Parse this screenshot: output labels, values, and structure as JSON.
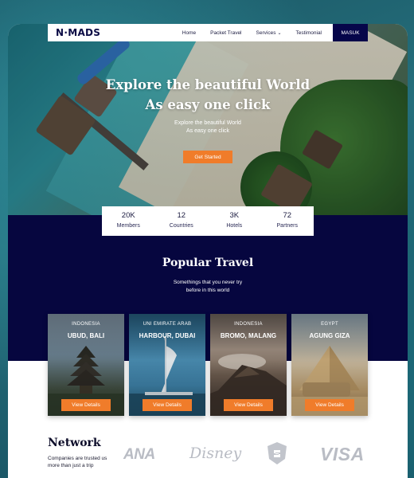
{
  "nav": {
    "logo": "N·MADS",
    "links": [
      "Home",
      "Packet Travel",
      "Services",
      "Testimonial"
    ],
    "cta": "MASUK"
  },
  "hero": {
    "title_line1": "Explore the beautiful World",
    "title_line2": "As easy one click",
    "sub_line1": "Explore the beautiful World",
    "sub_line2": "As easy one click",
    "cta": "Get Started"
  },
  "stats": [
    {
      "value": "20K",
      "label": "Members"
    },
    {
      "value": "12",
      "label": "Countries"
    },
    {
      "value": "3K",
      "label": "Hotels"
    },
    {
      "value": "72",
      "label": "Partners"
    }
  ],
  "popular": {
    "title": "Popular Travel",
    "sub_line1": "Somethings that you never try",
    "sub_line2": "before in this world"
  },
  "cards": [
    {
      "country": "INDONESIA",
      "city": "UBUD, BALI",
      "button": "View Details"
    },
    {
      "country": "UNI EMIRATE ARAB",
      "city": "HARBOUR, DUBAI",
      "button": "View Details"
    },
    {
      "country": "INDONESIA",
      "city": "BROMO, MALANG",
      "button": "View Details"
    },
    {
      "country": "EGYPT",
      "city": "AGUNG GIZA",
      "button": "View Details"
    }
  ],
  "network": {
    "title": "Network",
    "sub": "Companies are trusted us more than just a trip",
    "brands": [
      "ANA",
      "Disney",
      "VISA"
    ]
  },
  "colors": {
    "navy": "#06063f",
    "accent": "#f07c2a",
    "white": "#ffffff"
  }
}
